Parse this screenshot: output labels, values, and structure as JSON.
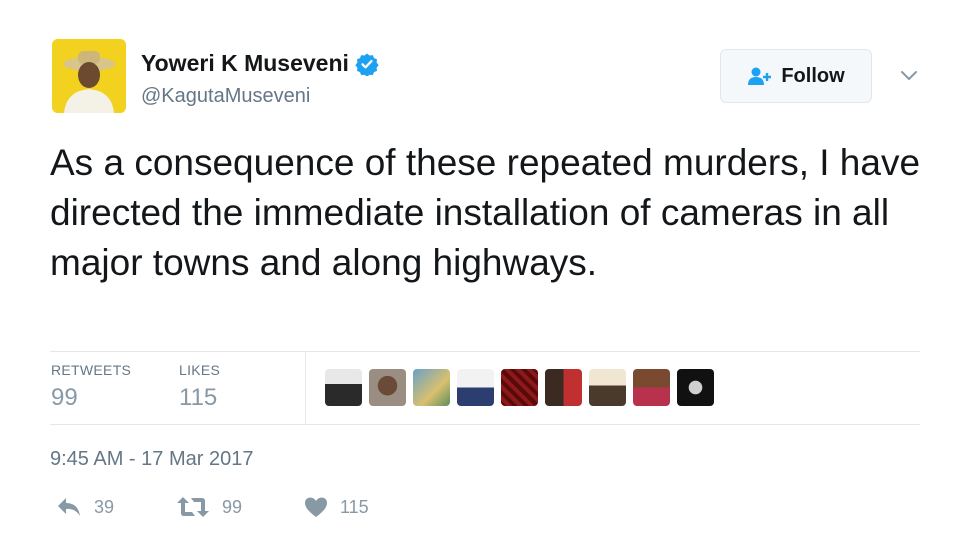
{
  "author": {
    "display_name": "Yoweri K Museveni",
    "handle": "@KagutaMuseveni",
    "verified": true
  },
  "follow_button": {
    "label": "Follow"
  },
  "tweet": {
    "text": "As a consequence of these repeated murders, I have directed the immediate installation of cameras in all major towns and along highways."
  },
  "stats": {
    "retweets_label": "RETWEETS",
    "retweets_value": "99",
    "likes_label": "LIKES",
    "likes_value": "115"
  },
  "timestamp": "9:45 AM - 17 Mar 2017",
  "actions": {
    "reply_count": "39",
    "retweet_count": "99",
    "like_count": "115"
  },
  "colors": {
    "text_primary": "#14171a",
    "text_secondary": "#657786",
    "action_gray": "#8899a6",
    "verified_blue": "#1da1f2",
    "divider": "#e1e8ed"
  }
}
